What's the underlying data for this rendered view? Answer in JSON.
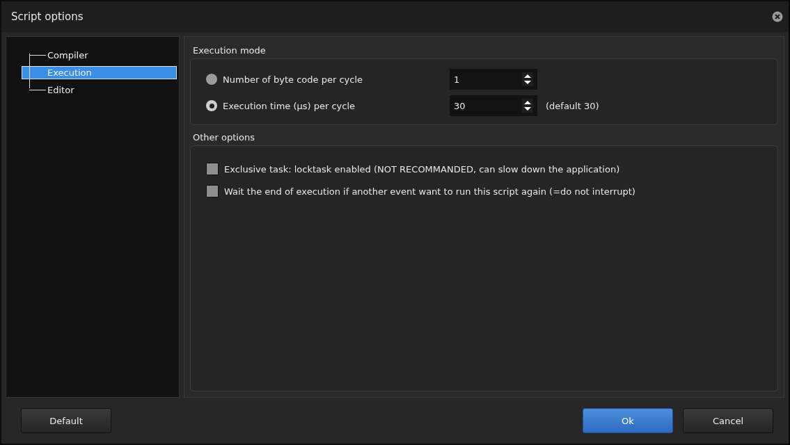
{
  "window": {
    "title": "Script options"
  },
  "tree": {
    "items": [
      {
        "label": "Compiler",
        "selected": false
      },
      {
        "label": "Execution",
        "selected": true
      },
      {
        "label": "Editor",
        "selected": false
      }
    ]
  },
  "execution_mode": {
    "title": "Execution mode",
    "options": [
      {
        "label": "Number of byte code per cycle",
        "selected": false,
        "value": "1"
      },
      {
        "label": "Execution time (µs) per cycle",
        "selected": true,
        "value": "30",
        "hint": "(default 30)"
      }
    ]
  },
  "other_options": {
    "title": "Other options",
    "items": [
      {
        "label": "Exclusive task: locktask enabled (NOT RECOMMANDED, can slow down the application)",
        "checked": false
      },
      {
        "label": "Wait the end of execution if another event want to run this script again (=do not interrupt)",
        "checked": false
      }
    ]
  },
  "buttons": [
    {
      "label": "Default",
      "kind": "plain"
    },
    {
      "label": "Ok",
      "kind": "primary"
    },
    {
      "label": "Cancel",
      "kind": "plain"
    }
  ]
}
